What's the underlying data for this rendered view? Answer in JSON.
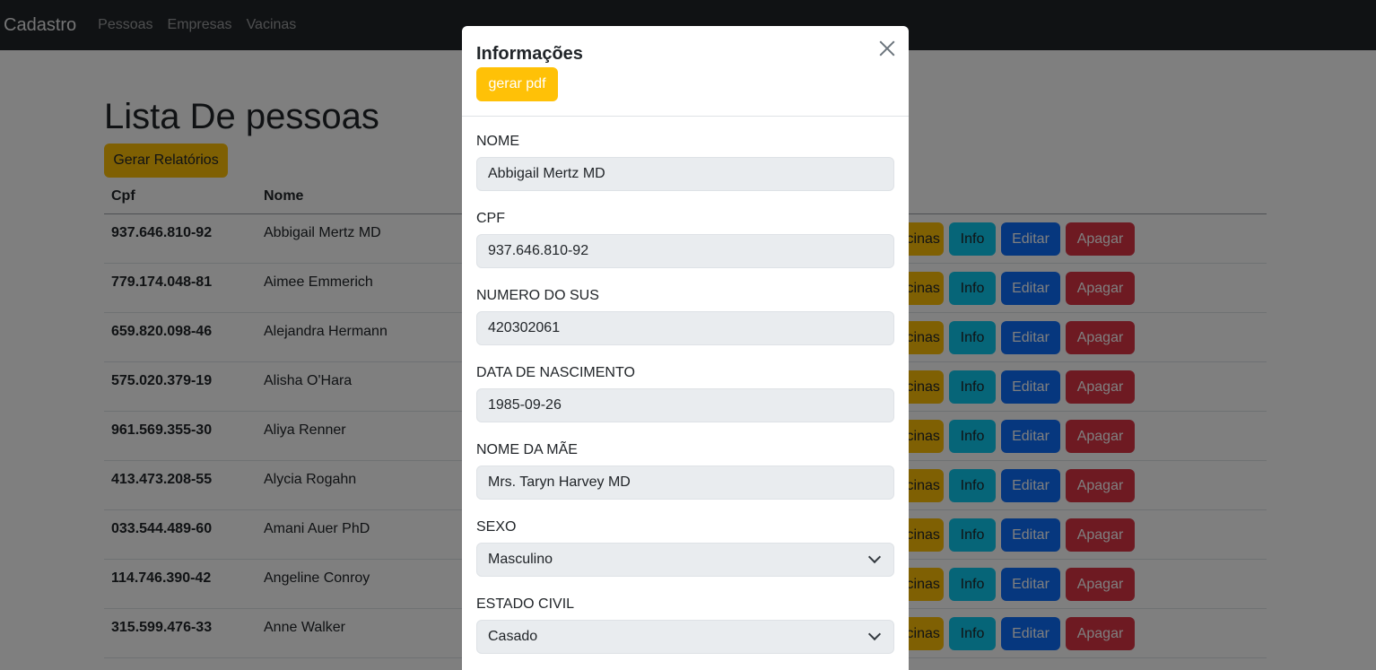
{
  "navbar": {
    "brand": "Cadastro",
    "links": [
      "Pessoas",
      "Empresas",
      "Vacinas"
    ]
  },
  "page": {
    "title": "Lista De pessoas",
    "report_button": "Gerar Relatórios"
  },
  "table": {
    "columns": [
      "Cpf",
      "Nome"
    ],
    "actions": {
      "vacinas": "Vacinas",
      "info": "Info",
      "editar": "Editar",
      "apagar": "Apagar"
    },
    "rows": [
      {
        "cpf": "937.646.810-92",
        "nome": "Abbigail Mertz MD"
      },
      {
        "cpf": "779.174.048-81",
        "nome": "Aimee Emmerich"
      },
      {
        "cpf": "659.820.098-46",
        "nome": "Alejandra Hermann"
      },
      {
        "cpf": "575.020.379-19",
        "nome": "Alisha O'Hara"
      },
      {
        "cpf": "961.569.355-30",
        "nome": "Aliya Renner"
      },
      {
        "cpf": "413.473.208-55",
        "nome": "Alycia Rogahn"
      },
      {
        "cpf": "033.544.489-60",
        "nome": "Amani Auer PhD"
      },
      {
        "cpf": "114.746.390-42",
        "nome": "Angeline Conroy"
      },
      {
        "cpf": "315.599.476-33",
        "nome": "Anne Walker"
      }
    ]
  },
  "modal": {
    "title": "Informações",
    "pdf_button": "gerar pdf",
    "fields": [
      {
        "label": "NOME",
        "value": "Abbigail Mertz MD",
        "type": "input"
      },
      {
        "label": "CPF",
        "value": "937.646.810-92",
        "type": "input"
      },
      {
        "label": "NUMERO DO SUS",
        "value": "420302061",
        "type": "input"
      },
      {
        "label": "DATA DE NASCIMENTO",
        "value": "1985-09-26",
        "type": "input"
      },
      {
        "label": "NOME DA MÃE",
        "value": "Mrs. Taryn Harvey MD",
        "type": "input"
      },
      {
        "label": "SEXO",
        "value": "Masculino",
        "type": "select"
      },
      {
        "label": "ESTADO CIVIL",
        "value": "Casado",
        "type": "select"
      }
    ]
  },
  "colors": {
    "navbar": "#212529",
    "warning": "#ffc107",
    "info": "#0dcaf0",
    "primary": "#0d6efd",
    "danger": "#dc3545"
  }
}
